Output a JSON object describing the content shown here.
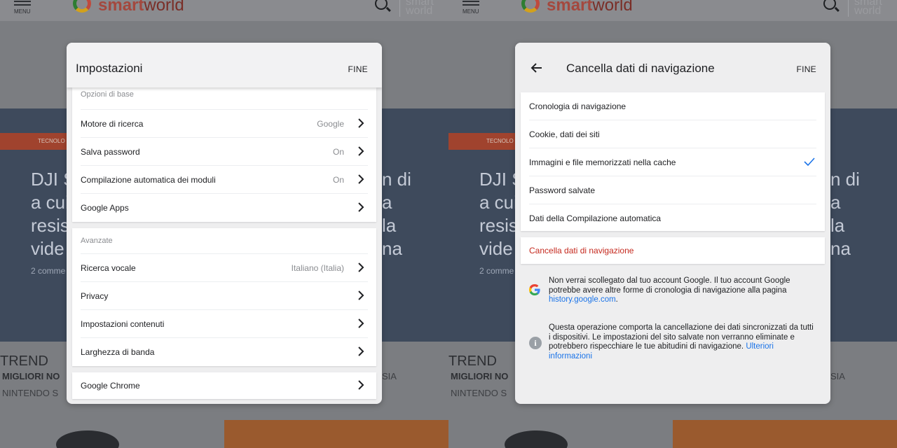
{
  "site": {
    "menu_label": "MENU",
    "logo_prefix": "smart",
    "logo_suffix": "world",
    "brand_mini_line1": "smart",
    "brand_mini_line2": "world",
    "hero_tag": "TECNOLO",
    "hero_title_lines": [
      "DJI S",
      "a cui",
      "resis",
      "vide"
    ],
    "hero_title_right_lines": [
      "n di",
      "a",
      "la",
      "na"
    ],
    "hero_comments": "2 comme",
    "trend_heading": "TREND",
    "trend_item1": "MIGLIORI NO",
    "trend_item2": "NINTENDO S",
    "trend_right": "SIA"
  },
  "settings_dialog": {
    "title": "Impostazioni",
    "done_label": "FINE",
    "basic_header": "Opzioni di base",
    "basic_items": [
      {
        "label": "Motore di ricerca",
        "value": "Google"
      },
      {
        "label": "Salva password",
        "value": "On"
      },
      {
        "label": "Compilazione automatica dei moduli",
        "value": "On"
      },
      {
        "label": "Google Apps",
        "value": ""
      }
    ],
    "advanced_header": "Avanzate",
    "advanced_items": [
      {
        "label": "Ricerca vocale",
        "value": "Italiano (Italia)"
      },
      {
        "label": "Privacy",
        "value": ""
      },
      {
        "label": "Impostazioni contenuti",
        "value": ""
      },
      {
        "label": "Larghezza di banda",
        "value": ""
      }
    ],
    "chrome_item": "Google Chrome"
  },
  "clear_dialog": {
    "title": "Cancella dati di navigazione",
    "done_label": "FINE",
    "items": [
      {
        "label": "Cronologia di navigazione",
        "checked": false
      },
      {
        "label": "Cookie, dati dei siti",
        "checked": false
      },
      {
        "label": "Immagini e file memorizzati nella cache",
        "checked": true
      },
      {
        "label": "Password salvate",
        "checked": false
      },
      {
        "label": "Dati della Compilazione automatica",
        "checked": false
      }
    ],
    "clear_button": "Cancella dati di navigazione",
    "info_google_text": "Non verrai scollegato dal tuo account Google. Il tuo account Google potrebbe avere altre forme di cronologia di navigazione alla pagina",
    "info_google_link": "history.google.com",
    "info_google_end": ".",
    "info_sync_text": "Questa operazione comporta la cancellazione dei dati sincronizzati da tutti i dispositivi. Le impostazioni del sito salvate non verranno eliminate e potrebbero rispecchiare le tue abitudini di navigazione.",
    "info_sync_link": "Ulteriori informazioni"
  },
  "colors": {
    "accent_blue": "#1a73e8",
    "danger_red": "#c5291e",
    "overlay_gray": "#7b7d81"
  }
}
